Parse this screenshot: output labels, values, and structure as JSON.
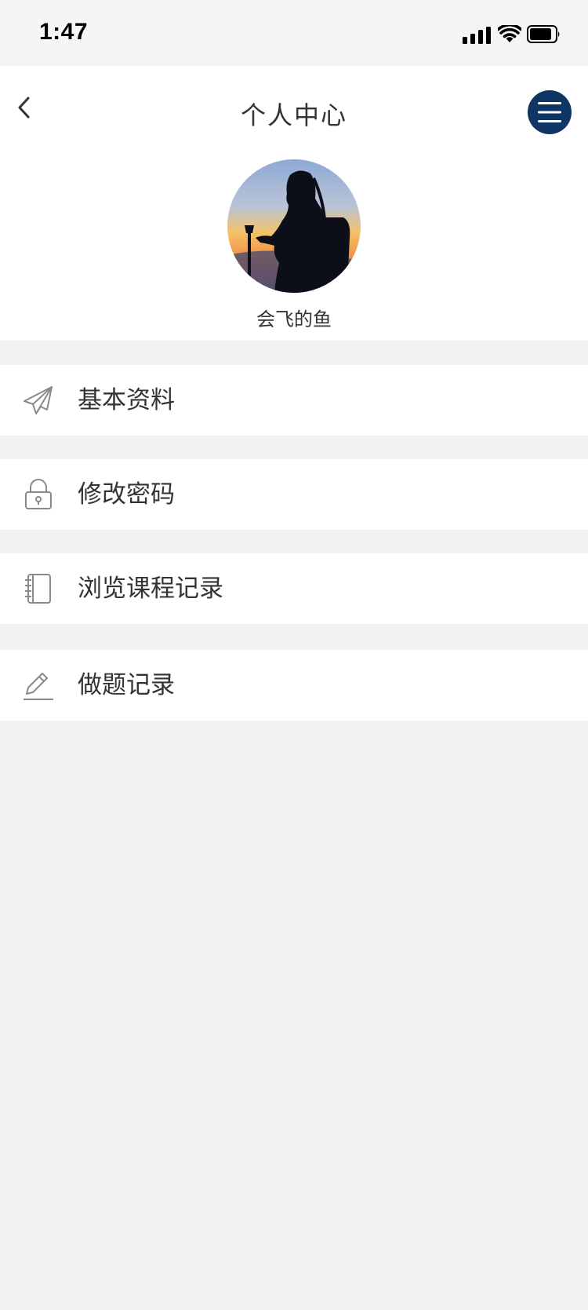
{
  "status_bar": {
    "time": "1:47",
    "icons": [
      "signal-icon",
      "wifi-icon",
      "battery-icon"
    ]
  },
  "header": {
    "title": "个人中心",
    "back_icon": "chevron-left-icon",
    "menu_icon": "hamburger-menu-icon",
    "menu_color": "#0e3563"
  },
  "profile": {
    "avatar": "avatar-photo",
    "username": "会飞的鱼"
  },
  "menu": [
    {
      "label": "基本资料",
      "icon": "paper-plane-icon"
    },
    {
      "label": "修改密码",
      "icon": "lock-icon"
    },
    {
      "label": "浏览课程记录",
      "icon": "notebook-icon"
    },
    {
      "label": "做题记录",
      "icon": "pencil-icon"
    }
  ]
}
